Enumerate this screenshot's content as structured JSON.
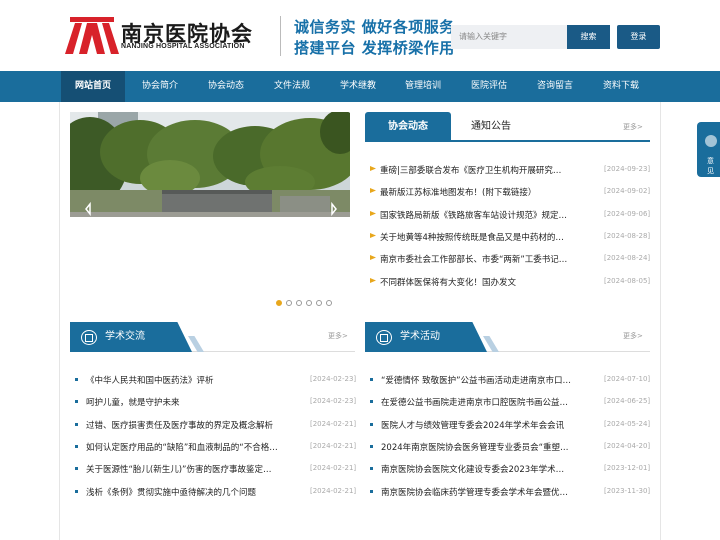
{
  "header": {
    "logo_cn": "南京医院协会",
    "logo_en": "NANJING HOSPITAL ASSOCIATION",
    "slogan_line1": "诚信务实 做好各项服务",
    "slogan_line2": "搭建平台 发挥桥梁作用",
    "search_placeholder": "请输入关键字",
    "search_label": "搜索",
    "login_label": "登录"
  },
  "nav": [
    "网站首页",
    "协会简介",
    "协会动态",
    "文件法规",
    "学术继教",
    "管理培训",
    "医院评估",
    "咨询留言",
    "资料下载"
  ],
  "news_tabs": {
    "active": "协会动态",
    "inactive": "通知公告",
    "more": "更多>"
  },
  "news": [
    {
      "title": "重磅|三部委联合发布《医疗卫生机构开展研究…",
      "date": "[2024-09-23]"
    },
    {
      "title": "最新版江苏标准地图发布！(附下载链接）",
      "date": "[2024-09-02]"
    },
    {
      "title": "国家铁路局新版《铁路旅客车站设计规范》规定…",
      "date": "[2024-09-06]"
    },
    {
      "title": "关于地黄等4种按照传统既是食品又是中药材的…",
      "date": "[2024-08-28]"
    },
    {
      "title": "南京市委社会工作部部长、市委“两新”工委书记…",
      "date": "[2024-08-24]"
    },
    {
      "title": "不同群体医保将有大变化！国办发文",
      "date": "[2024-08-05]"
    }
  ],
  "academic_exchange": {
    "title": "学术交流",
    "more": "更多>",
    "items": [
      {
        "title": "《中华人民共和国中医药法》评析",
        "date": "[2024-02-23]"
      },
      {
        "title": "呵护儿童，就是守护未来",
        "date": "[2024-02-23]"
      },
      {
        "title": "过错、医疗损害责任及医疗事故的界定及概念解析",
        "date": "[2024-02-21]"
      },
      {
        "title": "如何认定医疗用品的“缺陷”和血液制品的“不合格…",
        "date": "[2024-02-21]"
      },
      {
        "title": "关于医源性“胎儿(新生儿)”伤害的医疗事故鉴定…",
        "date": "[2024-02-21]"
      },
      {
        "title": "浅析《条例》贯彻实施中亟待解决的几个问题",
        "date": "[2024-02-21]"
      }
    ]
  },
  "academic_activity": {
    "title": "学术活动",
    "more": "更多>",
    "items": [
      {
        "title": "“爱德情怀 致敬医护”公益书画活动走进南京市口…",
        "date": "[2024-07-10]"
      },
      {
        "title": "在爱德公益书画院走进南京市口腔医院书画公益…",
        "date": "[2024-06-25]"
      },
      {
        "title": "医院人才与绩效管理专委会2024年学术年会会讯",
        "date": "[2024-05-24]"
      },
      {
        "title": "2024年南京医院协会医务管理专业委员会“重塑…",
        "date": "[2024-04-20]"
      },
      {
        "title": "南京医院协会医院文化建设专委会2023年学术…",
        "date": "[2023-12-01]"
      },
      {
        "title": "南京医院协会临床药学管理专委会学术年会暨优…",
        "date": "[2023-11-30]"
      }
    ]
  },
  "side_tab": "意见",
  "colors": {
    "primary": "#1a6d9c",
    "accent": "#e8a71c",
    "logo_red": "#d8222a"
  }
}
